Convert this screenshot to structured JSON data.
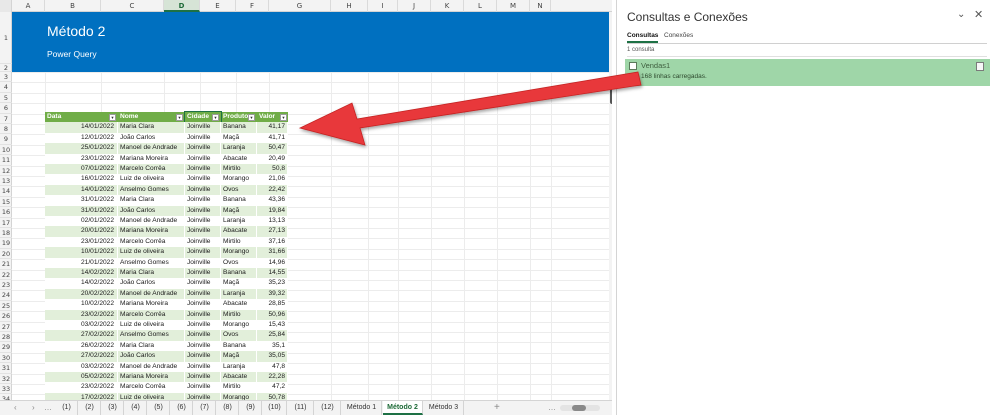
{
  "sheet": {
    "columns": [
      "A",
      "B",
      "C",
      "D",
      "E",
      "F",
      "G",
      "H",
      "I",
      "J",
      "K",
      "L",
      "M",
      "N"
    ],
    "selected_column": "D",
    "rows": [
      "1",
      "2",
      "3",
      "4",
      "5",
      "6",
      "7",
      "8",
      "9",
      "10",
      "11",
      "12",
      "13",
      "14",
      "15",
      "16",
      "17",
      "18",
      "19",
      "20",
      "21",
      "22",
      "23",
      "24",
      "25",
      "26",
      "27",
      "28",
      "29",
      "30",
      "31",
      "32",
      "33",
      "34"
    ]
  },
  "banner": {
    "title": "Método 2",
    "subtitle": "Power Query"
  },
  "table": {
    "headers": [
      "Data",
      "Nome",
      "Cidade",
      "Produto",
      "Valor"
    ],
    "selected_header": "Cidade",
    "rows": [
      [
        "14/01/2022",
        "Maria Clara",
        "Joinville",
        "Banana",
        "41,17"
      ],
      [
        "12/01/2022",
        "João Carlos",
        "Joinville",
        "Maçã",
        "41,71"
      ],
      [
        "25/01/2022",
        "Manoel de Andrade",
        "Joinville",
        "Laranja",
        "50,47"
      ],
      [
        "23/01/2022",
        "Mariana Moreira",
        "Joinville",
        "Abacate",
        "20,49"
      ],
      [
        "07/01/2022",
        "Marcelo Corrêa",
        "Joinville",
        "Mirtilo",
        "50,8"
      ],
      [
        "16/01/2022",
        "Luiz de oliveira",
        "Joinville",
        "Morango",
        "21,06"
      ],
      [
        "14/01/2022",
        "Anselmo Gomes",
        "Joinville",
        "Ovos",
        "22,42"
      ],
      [
        "31/01/2022",
        "Maria Clara",
        "Joinville",
        "Banana",
        "43,36"
      ],
      [
        "31/01/2022",
        "João Carlos",
        "Joinville",
        "Maçã",
        "19,84"
      ],
      [
        "02/01/2022",
        "Manoel de Andrade",
        "Joinville",
        "Laranja",
        "13,13"
      ],
      [
        "20/01/2022",
        "Mariana Moreira",
        "Joinville",
        "Abacate",
        "27,13"
      ],
      [
        "23/01/2022",
        "Marcelo Corrêa",
        "Joinville",
        "Mirtilo",
        "37,16"
      ],
      [
        "10/01/2022",
        "Luiz de oliveira",
        "Joinville",
        "Morango",
        "31,66"
      ],
      [
        "21/01/2022",
        "Anselmo Gomes",
        "Joinville",
        "Ovos",
        "14,96"
      ],
      [
        "14/02/2022",
        "Maria Clara",
        "Joinville",
        "Banana",
        "14,55"
      ],
      [
        "14/02/2022",
        "João Carlos",
        "Joinville",
        "Maçã",
        "35,23"
      ],
      [
        "20/02/2022",
        "Manoel de Andrade",
        "Joinville",
        "Laranja",
        "39,32"
      ],
      [
        "10/02/2022",
        "Mariana Moreira",
        "Joinville",
        "Abacate",
        "28,85"
      ],
      [
        "23/02/2022",
        "Marcelo Corrêa",
        "Joinville",
        "Mirtilo",
        "50,96"
      ],
      [
        "03/02/2022",
        "Luiz de oliveira",
        "Joinville",
        "Morango",
        "15,43"
      ],
      [
        "27/02/2022",
        "Anselmo Gomes",
        "Joinville",
        "Ovos",
        "25,84"
      ],
      [
        "26/02/2022",
        "Maria Clara",
        "Joinville",
        "Banana",
        "35,1"
      ],
      [
        "27/02/2022",
        "João Carlos",
        "Joinville",
        "Maçã",
        "35,05"
      ],
      [
        "03/02/2022",
        "Manoel de Andrade",
        "Joinville",
        "Laranja",
        "47,8"
      ],
      [
        "05/02/2022",
        "Mariana Moreira",
        "Joinville",
        "Abacate",
        "22,28"
      ],
      [
        "23/02/2022",
        "Marcelo Corrêa",
        "Joinville",
        "Mirtilo",
        "47,2"
      ],
      [
        "17/02/2022",
        "Luiz de oliveira",
        "Joinville",
        "Morango",
        "50,78"
      ]
    ]
  },
  "tabs": {
    "items": [
      "(1)",
      "(2)",
      "(3)",
      "(4)",
      "(5)",
      "(6)",
      "(7)",
      "(8)",
      "(9)",
      "(10)",
      "(11)",
      "(12)",
      "Método 1",
      "Método 2",
      "Método 3"
    ],
    "active": "Método 2",
    "add_label": "+",
    "nav_prev": "‹",
    "nav_next": "›",
    "more_left": "…",
    "more_right": "…"
  },
  "pane": {
    "title": "Consultas e Conexões",
    "collapse_glyph": "⌄",
    "close_glyph": "✕",
    "tab_queries": "Consultas",
    "tab_connections": "Conexões",
    "active_tab": "Consultas",
    "query_count": "1 consulta",
    "query": {
      "name": "Vendas1",
      "status": "168 linhas carregadas."
    }
  },
  "colors": {
    "banner": "#0070c0",
    "table_header": "#70ad47",
    "table_band": "#e2efda",
    "query_highlight": "#9fd6a8",
    "arrow": "#e8393a"
  }
}
